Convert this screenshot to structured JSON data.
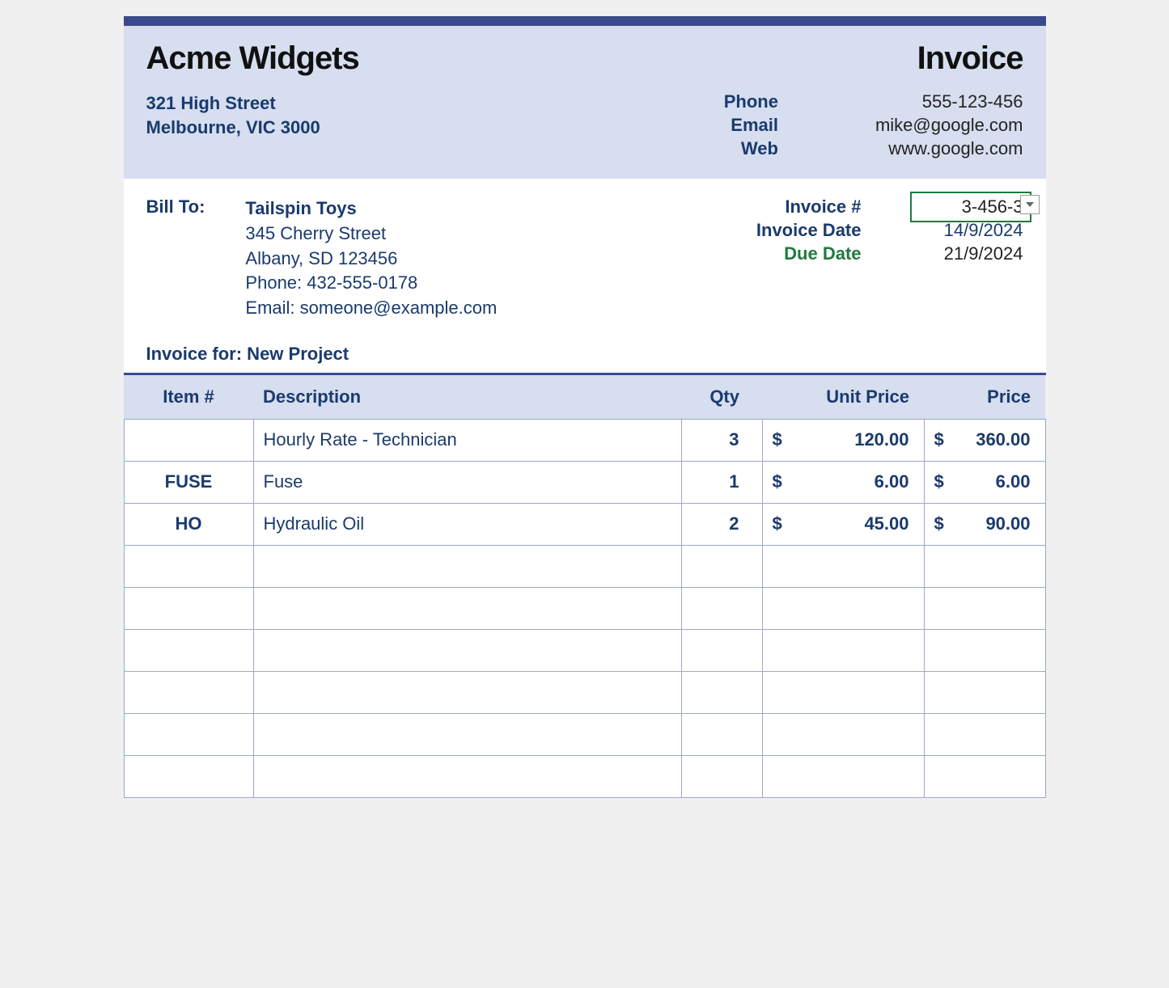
{
  "company": {
    "name": "Acme Widgets",
    "address_line1": "321 High Street",
    "address_line2": "Melbourne, VIC 3000"
  },
  "doc_type": "Invoice",
  "contact": {
    "phone_label": "Phone",
    "phone": "555-123-456",
    "email_label": "Email",
    "email": "mike@google.com",
    "web_label": "Web",
    "web": "www.google.com"
  },
  "bill_to": {
    "label": "Bill To:",
    "name": "Tailspin Toys",
    "street": "345 Cherry Street",
    "city": "Albany, SD 123456",
    "phone": "Phone: 432-555-0178",
    "email": "Email: someone@example.com"
  },
  "meta": {
    "invoice_number_label": "Invoice #",
    "invoice_number": "3-456-3",
    "invoice_date_label": "Invoice Date",
    "invoice_date": "14/9/2024",
    "due_date_label": "Due Date",
    "due_date": "21/9/2024"
  },
  "invoice_for": "Invoice for: New Project",
  "columns": {
    "item": "Item #",
    "description": "Description",
    "qty": "Qty",
    "unit_price": "Unit Price",
    "price": "Price"
  },
  "currency": "$",
  "line_items": [
    {
      "item": "",
      "description": "Hourly Rate - Technician",
      "qty": "3",
      "unit_price": "120.00",
      "price": "360.00"
    },
    {
      "item": "FUSE",
      "description": "Fuse",
      "qty": "1",
      "unit_price": "6.00",
      "price": "6.00"
    },
    {
      "item": "HO",
      "description": "Hydraulic Oil",
      "qty": "2",
      "unit_price": "45.00",
      "price": "90.00"
    }
  ],
  "empty_rows": 6
}
